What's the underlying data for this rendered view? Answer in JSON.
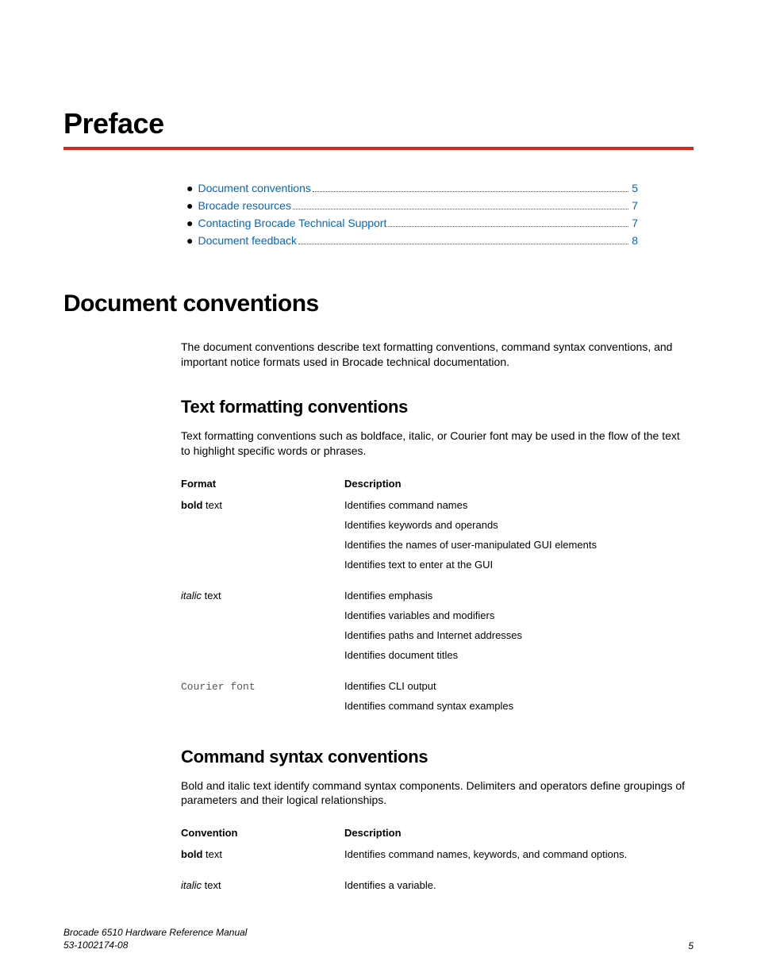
{
  "chapter_title": "Preface",
  "toc": [
    {
      "label": "Document conventions",
      "page": "5"
    },
    {
      "label": "Brocade resources",
      "page": "7"
    },
    {
      "label": "Contacting Brocade Technical Support",
      "page": "7"
    },
    {
      "label": "Document feedback",
      "page": "8"
    }
  ],
  "section1": {
    "title": "Document conventions",
    "intro": "The document conventions describe text formatting conventions, command syntax conventions, and important notice formats used in Brocade technical documentation."
  },
  "textfmt": {
    "title": "Text formatting conventions",
    "intro": "Text formatting conventions such as boldface, italic, or Courier font may be used in the flow of the text to highlight specific words or phrases.",
    "head_col1": "Format",
    "head_col2": "Description",
    "rows": [
      {
        "fmt_prefix": "bold",
        "fmt_suffix": " text",
        "style": "bold",
        "lines": [
          "Identifies command names",
          "Identifies keywords and operands",
          "Identifies the names of user-manipulated GUI elements",
          "Identifies text to enter at the GUI"
        ]
      },
      {
        "fmt_prefix": "italic",
        "fmt_suffix": " text",
        "style": "italic",
        "lines": [
          "Identifies emphasis",
          "Identifies variables and modifiers",
          "Identifies paths and Internet addresses",
          "Identifies document titles"
        ]
      },
      {
        "fmt_prefix": "Courier font",
        "fmt_suffix": "",
        "style": "mono",
        "lines": [
          "Identifies CLI output",
          "Identifies command syntax examples"
        ]
      }
    ]
  },
  "cmdsyn": {
    "title": "Command syntax conventions",
    "intro": "Bold and italic text identify command syntax components. Delimiters and operators define groupings of parameters and their logical relationships.",
    "head_col1": "Convention",
    "head_col2": "Description",
    "rows": [
      {
        "fmt_prefix": "bold",
        "fmt_suffix": " text",
        "style": "bold",
        "lines": [
          "Identifies command names, keywords, and command options."
        ]
      },
      {
        "fmt_prefix": "italic",
        "fmt_suffix": " text",
        "style": "italic",
        "lines": [
          "Identifies a variable."
        ]
      }
    ]
  },
  "footer": {
    "line1": "Brocade 6510 Hardware Reference Manual",
    "line2": "53-1002174-08",
    "page": "5"
  }
}
